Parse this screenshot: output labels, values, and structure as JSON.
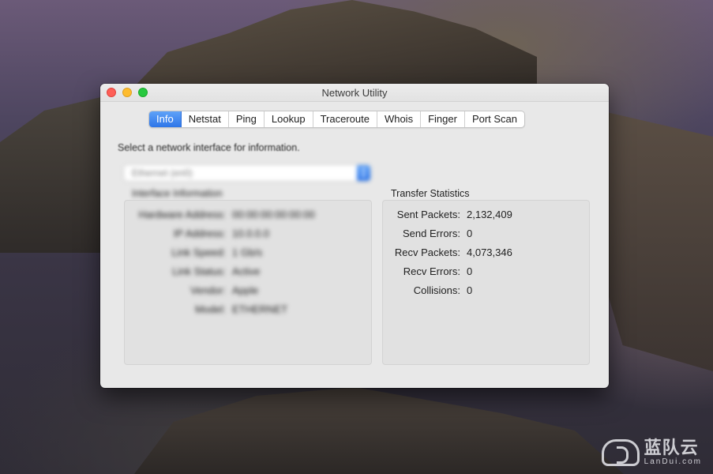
{
  "window": {
    "title": "Network Utility"
  },
  "tabs": [
    {
      "label": "Info",
      "active": true
    },
    {
      "label": "Netstat",
      "active": false
    },
    {
      "label": "Ping",
      "active": false
    },
    {
      "label": "Lookup",
      "active": false
    },
    {
      "label": "Traceroute",
      "active": false
    },
    {
      "label": "Whois",
      "active": false
    },
    {
      "label": "Finger",
      "active": false
    },
    {
      "label": "Port Scan",
      "active": false
    }
  ],
  "interface": {
    "prompt": "Select a network interface for information.",
    "selected": "Ethernet (en0)",
    "group_title": "Interface Information",
    "rows": [
      {
        "label": "Hardware Address:",
        "value": "00:00:00:00:00:00"
      },
      {
        "label": "IP Address:",
        "value": "10.0.0.0"
      },
      {
        "label": "Link Speed:",
        "value": "1 Gb/s"
      },
      {
        "label": "Link Status:",
        "value": "Active"
      },
      {
        "label": "Vendor:",
        "value": "Apple"
      },
      {
        "label": "Model:",
        "value": "ETHERNET"
      }
    ]
  },
  "transfer": {
    "title": "Transfer Statistics",
    "rows": [
      {
        "label": "Sent Packets:",
        "value": "2,132,409"
      },
      {
        "label": "Send Errors:",
        "value": "0"
      },
      {
        "label": "Recv Packets:",
        "value": "4,073,346"
      },
      {
        "label": "Recv Errors:",
        "value": "0"
      },
      {
        "label": "Collisions:",
        "value": "0"
      }
    ]
  },
  "watermark": {
    "cn": "蓝队云",
    "en": "LanDui.com"
  },
  "colors": {
    "accent": "#2d75e8",
    "close": "#fe5f57",
    "minimize": "#febc2e",
    "zoom": "#28c840"
  }
}
